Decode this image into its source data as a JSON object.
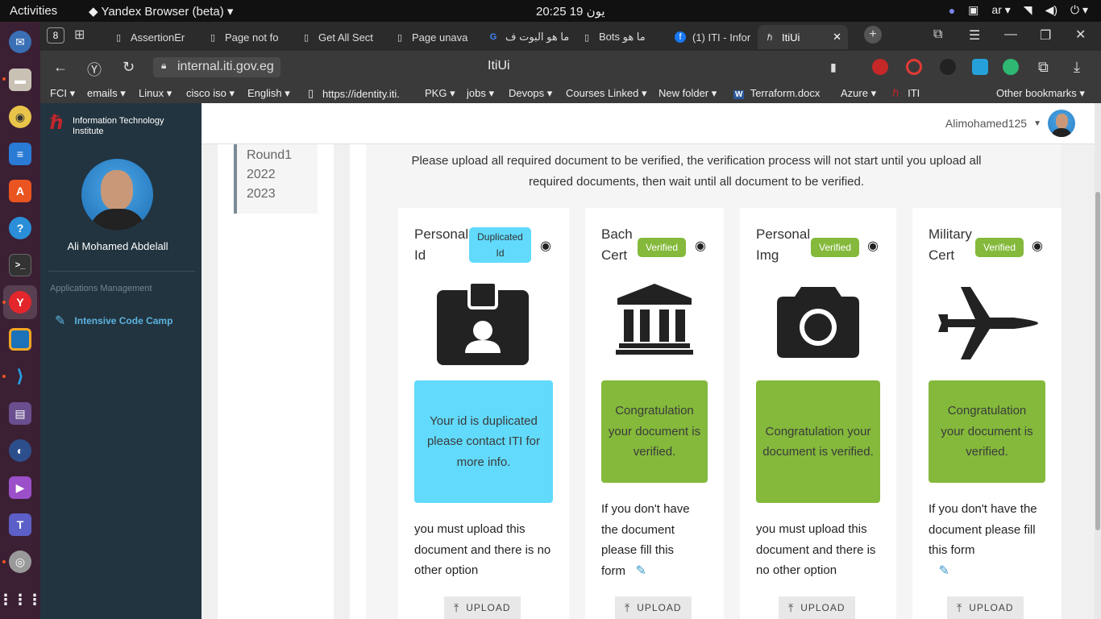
{
  "os": {
    "activities": "Activities",
    "app_name": "Yandex Browser (beta)",
    "clock": "20:25  يون 19",
    "lang": "ar"
  },
  "browser": {
    "tab_count": "8",
    "tabs": [
      {
        "label": "AssertionEr"
      },
      {
        "label": "Page not fo"
      },
      {
        "label": "Get All Sect"
      },
      {
        "label": "Page unava"
      },
      {
        "label": "ما هو البوت ف"
      },
      {
        "label": "Bots ما هو"
      },
      {
        "label": "(1) ITI - Infor"
      },
      {
        "label": "ItiUi"
      }
    ],
    "url": "internal.iti.gov.eg",
    "page_title": "ItiUi",
    "bookmarks": [
      "FCI",
      "emails",
      "Linux",
      "cisco iso",
      "English",
      "https://identity.iti.",
      "PKG",
      "jobs",
      "Devops",
      "Courses Linked",
      "New folder",
      "Terraform.docx",
      "Azure",
      "ITI",
      "Other bookmarks"
    ]
  },
  "sidebar": {
    "logo_text_1": "Information Technology",
    "logo_text_2": "Institute",
    "user_name": "Ali Mohamed Abdelall",
    "section_title": "Applications Management",
    "nav_item": "Intensive Code Camp"
  },
  "header": {
    "username": "Alimohamed125"
  },
  "rounds": {
    "line1": "Round1",
    "line2": "2022",
    "line3": "2023"
  },
  "notice": "Please upload all required document to be verified, the verification process will not start until you upload all required documents, then wait until all document to be verified.",
  "cards": [
    {
      "title_1": "Personal",
      "title_2": "Id",
      "badge_1": "Duplicated",
      "badge_2": "Id",
      "icon": "id-badge-icon",
      "message": "Your id is duplicated please contact ITI for more info.",
      "note": "you must upload this document and there is no other option",
      "upload": "UPLOAD",
      "status_color": "#61dafb"
    },
    {
      "title_1": "Bach",
      "title_2": "Cert",
      "badge": "Verified",
      "icon": "university-icon",
      "message": "Congratulation your document is verified.",
      "note": "If you don't have the document please fill this form",
      "upload": "UPLOAD",
      "status_color": "#84b93b"
    },
    {
      "title_1": "Personal",
      "title_2": "Img",
      "badge": "Verified",
      "icon": "camera-icon",
      "message": "Congratulation your document is verified.",
      "note": "you must upload this document and there is no other option",
      "upload": "UPLOAD",
      "status_color": "#84b93b"
    },
    {
      "title_1": "Military",
      "title_2": "Cert",
      "badge": "Verified",
      "icon": "fighter-jet-icon",
      "message": "Congratulation your document is verified.",
      "note": "If you don't have the document please fill this form",
      "upload": "UPLOAD",
      "status_color": "#84b93b"
    }
  ]
}
